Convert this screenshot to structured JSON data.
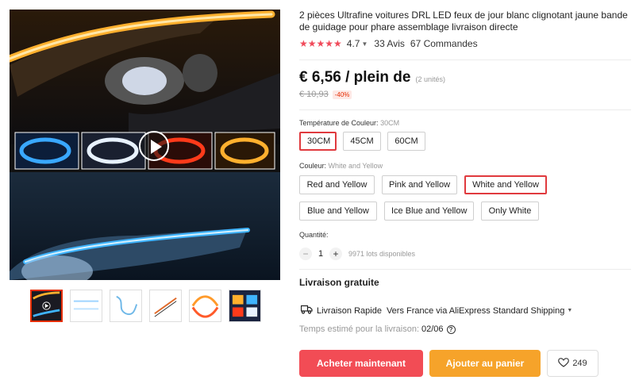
{
  "product": {
    "title": "2 pièces Ultrafine voitures DRL LED feux de jour blanc clignotant jaune bande de guidage pour phare assemblage livraison directe",
    "stars": "★★★★★",
    "rating": "4.7",
    "reviews": "33 Avis",
    "orders": "67 Commandes",
    "price": "€ 6,56 / plein de",
    "units": "(2 unités)",
    "original_price": "€ 10,93",
    "discount": "-40%"
  },
  "color_temp": {
    "label": "Température de Couleur:",
    "selected": "30CM",
    "options": [
      "30CM",
      "45CM",
      "60CM"
    ]
  },
  "color": {
    "label": "Couleur:",
    "selected": "White and Yellow",
    "options": [
      "Red and Yellow",
      "Pink and Yellow",
      "White and Yellow",
      "Blue and Yellow",
      "Ice Blue and Yellow",
      "Only White"
    ]
  },
  "quantity": {
    "label": "Quantité:",
    "minus": "−",
    "plus": "+",
    "value": "1",
    "stock": "9971 lots disponibles"
  },
  "shipping": {
    "free": "Livraison gratuite",
    "method": "Livraison Rapide",
    "detail": "Vers France via AliExpress Standard Shipping",
    "eta_label": "Temps estimé pour la livraison:",
    "eta_date": "02/06",
    "help": "?"
  },
  "actions": {
    "buy_now": "Acheter maintenant",
    "add_to_cart": "Ajouter au panier",
    "wishlist_count": "249"
  },
  "colors": {
    "accent_red": "#f24c55",
    "cart_orange": "#f6a32a",
    "star_red": "#f04a5a",
    "selected_border": "#e03a3e"
  },
  "icons": {
    "play": "play-icon",
    "truck": "truck-icon",
    "heart": "heart-icon",
    "help": "question-circle-icon"
  }
}
